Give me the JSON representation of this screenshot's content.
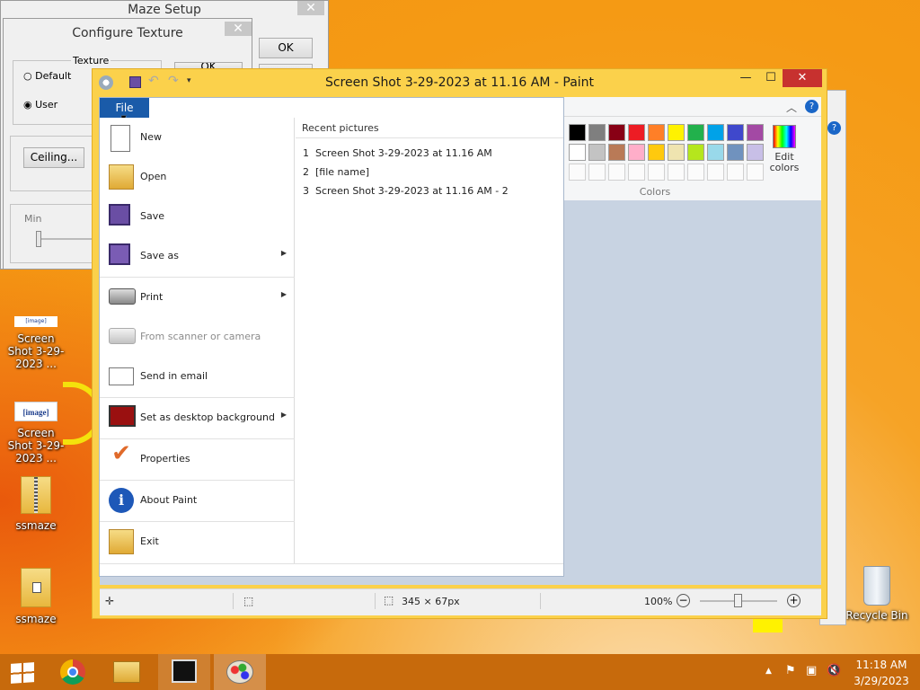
{
  "maze_setup": {
    "title": "Maze Setup",
    "ok_label": "OK"
  },
  "configure_texture": {
    "title": "Configure Texture",
    "group_label": "Texture",
    "option_default": "Default",
    "option_user": "User",
    "ok_label": "OK",
    "ceiling_label": "Ceiling...",
    "min_label": "Min"
  },
  "desktop": {
    "icons": [
      {
        "tiny_banner": "[image]",
        "label": "Screen Shot 3-29-2023 ..."
      },
      {
        "banner": "[image]",
        "label": "Screen Shot 3-29-2023 ..."
      },
      {
        "label": "ssmaze"
      },
      {
        "label": "ssmaze"
      },
      {
        "label": "Recycle Bin"
      }
    ]
  },
  "paint": {
    "title": "Screen Shot 3-29-2023 at 11.16 AM - Paint",
    "window_buttons": {
      "minimize": "—",
      "maximize": "☐",
      "close": "✕"
    },
    "file_tab": "File",
    "recent_heading": "Recent pictures",
    "recent": [
      {
        "num": "1",
        "name": "Screen Shot 3-29-2023 at 11.16 AM"
      },
      {
        "num": "2",
        "name": "[file name]"
      },
      {
        "num": "3",
        "name": "Screen Shot 3-29-2023 at 11.16 AM - 2"
      }
    ],
    "menu": {
      "new": "New",
      "open": "Open",
      "save": "Save",
      "save_as": "Save as",
      "print": "Print",
      "scanner": "From scanner or camera",
      "email": "Send in email",
      "desktop_bg": "Set as desktop background",
      "properties": "Properties",
      "about": "About Paint",
      "exit": "Exit"
    },
    "colors_label": "Colors",
    "edit_colors": "Edit colors",
    "status": {
      "size": "345 × 67px",
      "zoom": "100%"
    },
    "palette_row1": [
      "#000000",
      "#7f7f7f",
      "#880015",
      "#ed1c24",
      "#ff7f27",
      "#fff200",
      "#22b14c",
      "#00a2e8",
      "#3f48cc",
      "#a349a4"
    ],
    "palette_row2": [
      "#ffffff",
      "#c3c3c3",
      "#b97a57",
      "#ffaec9",
      "#ffc90e",
      "#efe4b0",
      "#b5e61d",
      "#99d9ea",
      "#7092be",
      "#c8bfe7"
    ]
  },
  "taskbar": {
    "time": "11:18 AM",
    "date": "3/29/2023"
  }
}
